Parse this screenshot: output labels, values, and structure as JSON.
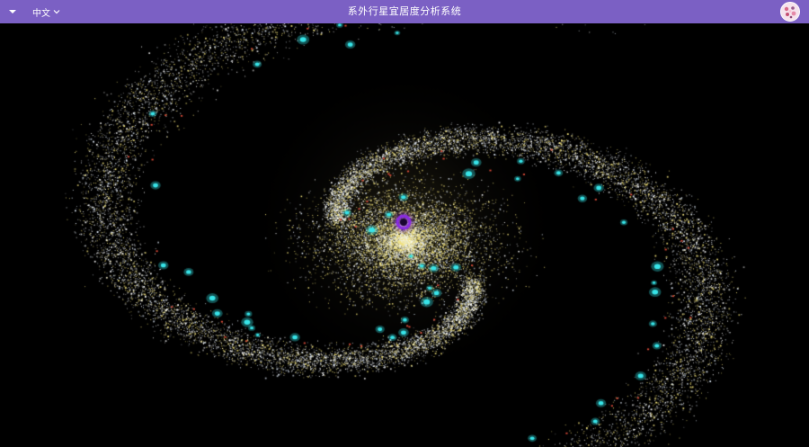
{
  "header": {
    "title": "系外行星宜居度分析系统",
    "language_label": "中文",
    "menu_icon": "caret-down-icon",
    "language_chevron_icon": "chevron-down-icon",
    "background_color": "#7b60c4"
  },
  "avatar": {
    "icon": "user-avatar-image"
  },
  "scene": {
    "type": "3d-galaxy-point-cloud",
    "background_color": "#000000",
    "star_colors": [
      "#ffffff",
      "#f2e27a",
      "#e6f1ff",
      "#d9c45a"
    ],
    "planet_marker_colors": {
      "habitable": "#37e4e8",
      "non_habitable": "#e8503c"
    },
    "center_marker_color": "#8a2be2"
  }
}
